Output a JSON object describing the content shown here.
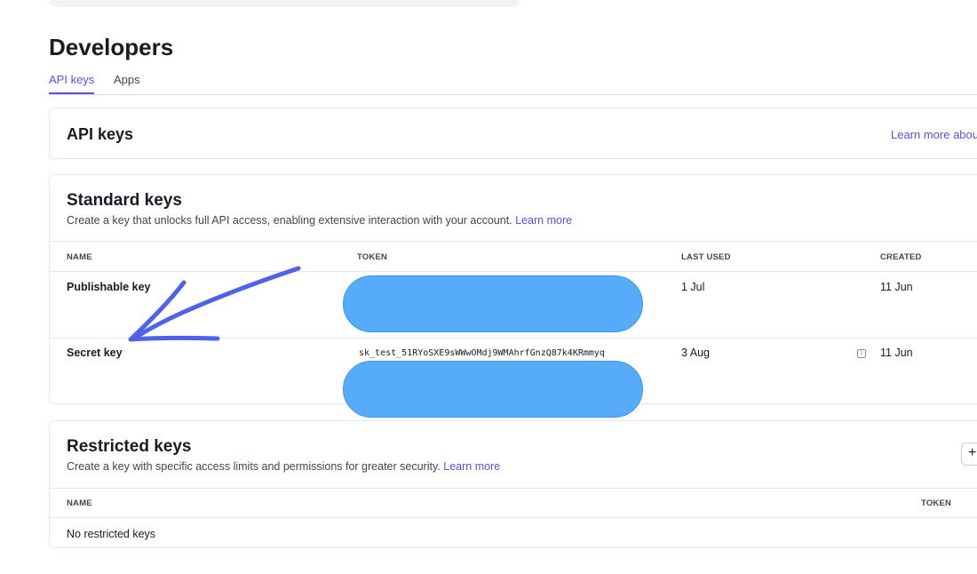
{
  "page": {
    "title": "Developers",
    "tabs": [
      {
        "label": "API keys",
        "active": true
      },
      {
        "label": "Apps",
        "active": false
      }
    ]
  },
  "api_keys_card": {
    "title": "API keys",
    "learn_more": "Learn more abou"
  },
  "standard_keys": {
    "title": "Standard keys",
    "description": "Create a key that unlocks full API access, enabling extensive interaction with your account.",
    "learn_more": "Learn more",
    "columns": [
      "NAME",
      "TOKEN",
      "LAST USED",
      "CREATED"
    ],
    "rows": [
      {
        "name": "Publishable key",
        "token": "",
        "last_used": "1 Jul",
        "created": "11 Jun"
      },
      {
        "name": "Secret key",
        "token": "sk_test_51RYoSXE9sWWwOMdj9WMAhrfGnzQ87k4KRmmyq",
        "last_used": "3 Aug",
        "created": "11 Jun"
      }
    ]
  },
  "restricted_keys": {
    "title": "Restricted keys",
    "description": "Create a key with specific access limits and permissions for greater security.",
    "learn_more": "Learn more",
    "columns": [
      "NAME",
      "TOKEN"
    ],
    "empty_text": "No restricted keys",
    "add_button": "+"
  },
  "colors": {
    "accent": "#5b4fe8",
    "redaction": "#57acfa",
    "annotation_arrow": "#4f63ea"
  },
  "icons": {
    "info": "info-icon",
    "annotation": "arrow-annotation-icon"
  }
}
